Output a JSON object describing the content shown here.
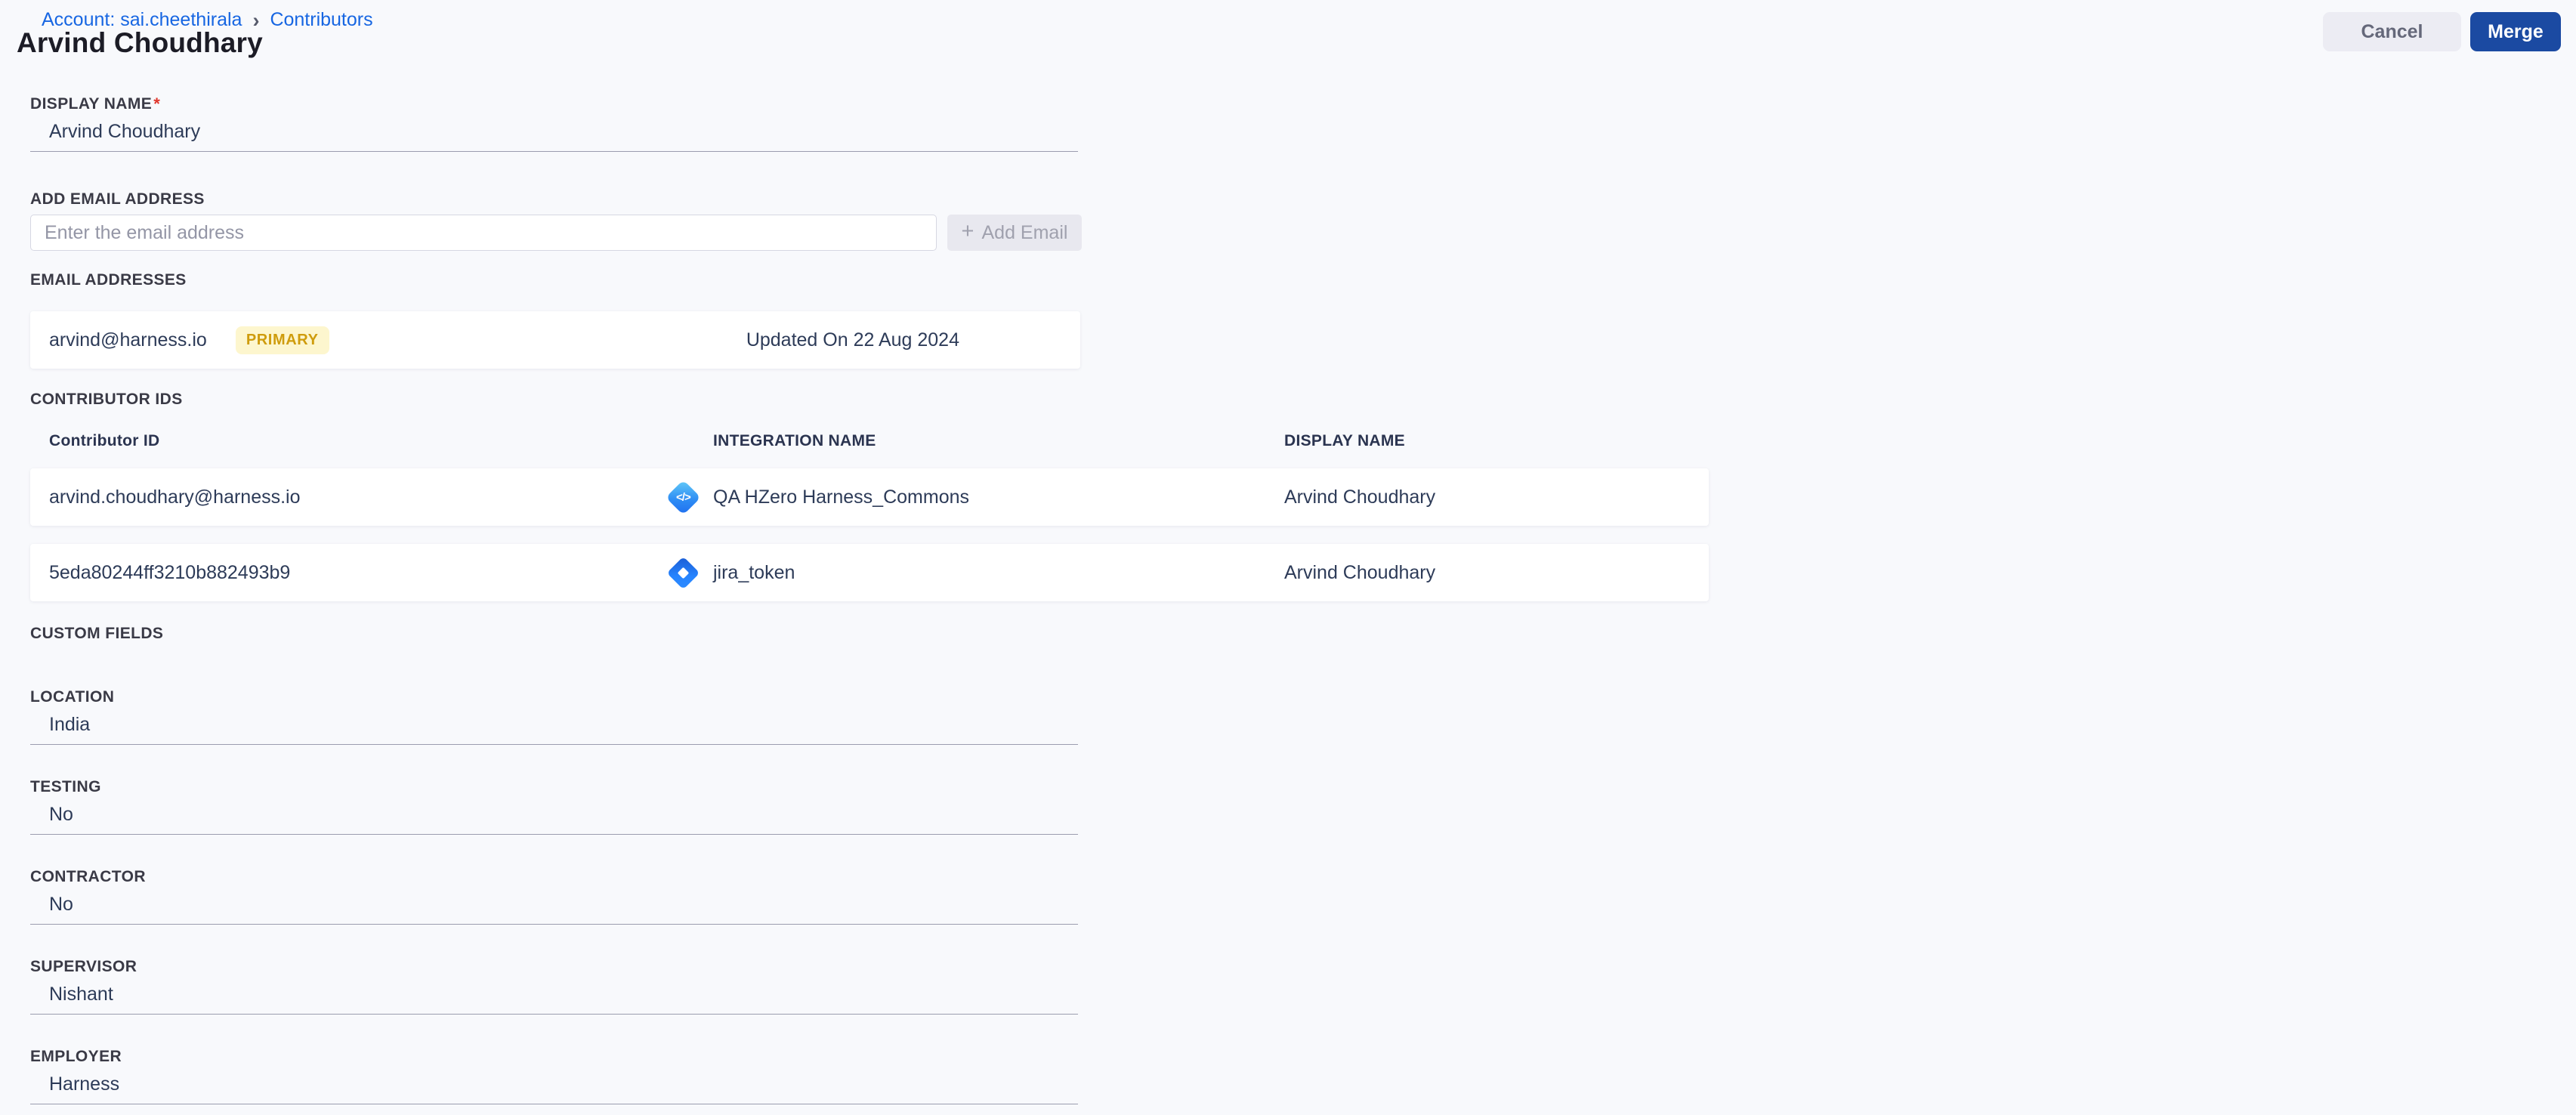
{
  "breadcrumb": {
    "account": "Account: sai.cheethirala",
    "separator": "›",
    "current": "Contributors"
  },
  "header": {
    "title": "Arvind Choudhary",
    "cancel_label": "Cancel",
    "merge_label": "Merge"
  },
  "display_name": {
    "label": "DISPLAY NAME",
    "required_marker": "*",
    "value": "Arvind Choudhary"
  },
  "add_email": {
    "label": "ADD EMAIL ADDRESS",
    "placeholder": "Enter the email address",
    "button_label": "Add Email",
    "plus_icon": "+"
  },
  "emails": {
    "label": "EMAIL ADDRESSES",
    "items": [
      {
        "address": "arvind@harness.io",
        "badge": "PRIMARY",
        "updated": "Updated On 22 Aug 2024"
      }
    ]
  },
  "contributor_ids": {
    "label": "CONTRIBUTOR IDS",
    "headers": {
      "id": "Contributor ID",
      "integration": "INTEGRATION NAME",
      "display_name": "DISPLAY NAME"
    },
    "rows": [
      {
        "id": "arvind.choudhary@harness.io",
        "icon": "code-integration-icon",
        "icon_glyph": "</>",
        "integration": "QA HZero Harness_Commons",
        "display_name": "Arvind Choudhary"
      },
      {
        "id": "5eda80244ff3210b882493b9",
        "icon": "jira-icon",
        "integration": "jira_token",
        "display_name": "Arvind Choudhary"
      }
    ]
  },
  "custom_fields": {
    "label": "CUSTOM FIELDS",
    "fields": [
      {
        "label": "LOCATION",
        "value": "India"
      },
      {
        "label": "TESTING",
        "value": "No"
      },
      {
        "label": "CONTRACTOR",
        "value": "No"
      },
      {
        "label": "SUPERVISOR",
        "value": "Nishant"
      },
      {
        "label": "EMPLOYER",
        "value": "Harness"
      }
    ]
  },
  "colors": {
    "page_bg": "#f8f9fc",
    "link_blue": "#1766e2",
    "merge_button_bg": "#1b4aa2",
    "badge_bg": "#fdf6ce",
    "badge_text": "#cf9c0d",
    "value_text": "#2d3b58"
  }
}
